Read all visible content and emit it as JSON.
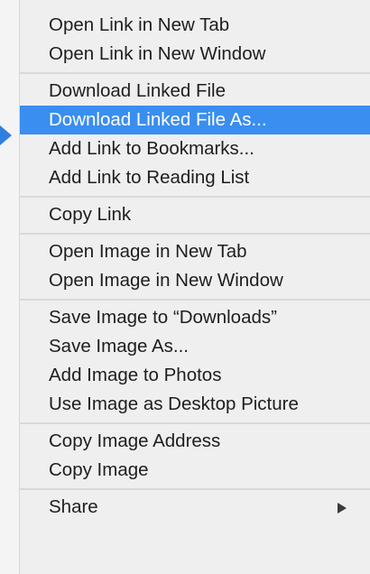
{
  "context_menu": {
    "groups": [
      {
        "items": [
          {
            "label": "Open Link in New Tab"
          },
          {
            "label": "Open Link in New Window"
          }
        ]
      },
      {
        "items": [
          {
            "label": "Download Linked File"
          },
          {
            "label": "Download Linked File As..."
          },
          {
            "label": "Add Link to Bookmarks..."
          },
          {
            "label": "Add Link to Reading List"
          }
        ]
      },
      {
        "items": [
          {
            "label": "Copy Link"
          }
        ]
      },
      {
        "items": [
          {
            "label": "Open Image in New Tab"
          },
          {
            "label": "Open Image in New Window"
          }
        ]
      },
      {
        "items": [
          {
            "label": "Save Image to “Downloads”"
          },
          {
            "label": "Save Image As..."
          },
          {
            "label": "Add Image to Photos"
          },
          {
            "label": "Use Image as Desktop Picture"
          }
        ]
      },
      {
        "items": [
          {
            "label": "Copy Image Address"
          },
          {
            "label": "Copy Image"
          }
        ]
      },
      {
        "items": [
          {
            "label": "Share"
          }
        ]
      }
    ],
    "selected_item": "Download Linked File As...",
    "highlight_color": "#3a8ef0",
    "pointer_color": "#2f7fe0",
    "pointer_icon": "pointer-arrow-icon",
    "submenu_icon": "chevron-right-icon"
  }
}
